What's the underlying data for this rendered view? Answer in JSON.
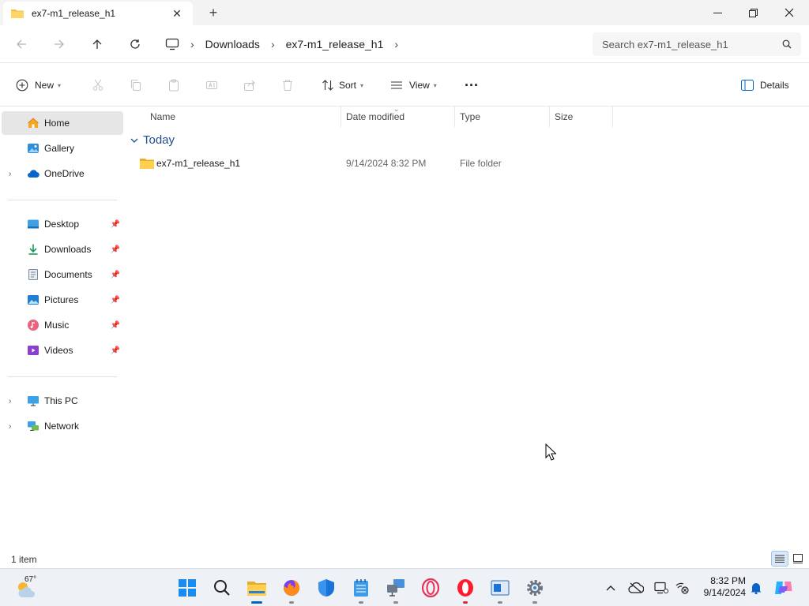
{
  "window": {
    "tab_title": "ex7-m1_release_h1",
    "new_tab": "+",
    "minimize": "—",
    "close": "✕"
  },
  "address": {
    "crumbs": [
      "Downloads",
      "ex7-m1_release_h1"
    ],
    "search_placeholder": "Search ex7-m1_release_h1"
  },
  "toolbar": {
    "new_label": "New",
    "sort_label": "Sort",
    "view_label": "View",
    "more_label": "···",
    "details_label": "Details"
  },
  "sidebar": {
    "quick": [
      {
        "label": "Home",
        "icon": "home-icon",
        "selected": true
      },
      {
        "label": "Gallery",
        "icon": "gallery-icon"
      },
      {
        "label": "OneDrive",
        "icon": "cloud-icon",
        "expandable": true
      }
    ],
    "pinned": [
      {
        "label": "Desktop",
        "icon": "desktop-icon"
      },
      {
        "label": "Downloads",
        "icon": "download-icon"
      },
      {
        "label": "Documents",
        "icon": "document-icon"
      },
      {
        "label": "Pictures",
        "icon": "picture-icon"
      },
      {
        "label": "Music",
        "icon": "music-icon"
      },
      {
        "label": "Videos",
        "icon": "video-icon"
      }
    ],
    "devices": [
      {
        "label": "This PC",
        "icon": "pc-icon"
      },
      {
        "label": "Network",
        "icon": "network-icon"
      }
    ]
  },
  "columns": {
    "name": "Name",
    "date": "Date modified",
    "type": "Type",
    "size": "Size"
  },
  "group_label": "Today",
  "files": [
    {
      "name": "ex7-m1_release_h1",
      "date": "9/14/2024 8:32 PM",
      "type": "File folder",
      "size": ""
    }
  ],
  "status": {
    "count": "1 item"
  },
  "taskbar": {
    "weather_temp": "67°",
    "time": "8:32 PM",
    "date": "9/14/2024"
  },
  "colors": {
    "accent": "#0067c0",
    "folder": "#f2c14e",
    "selected_bg": "#e6e6e6"
  }
}
